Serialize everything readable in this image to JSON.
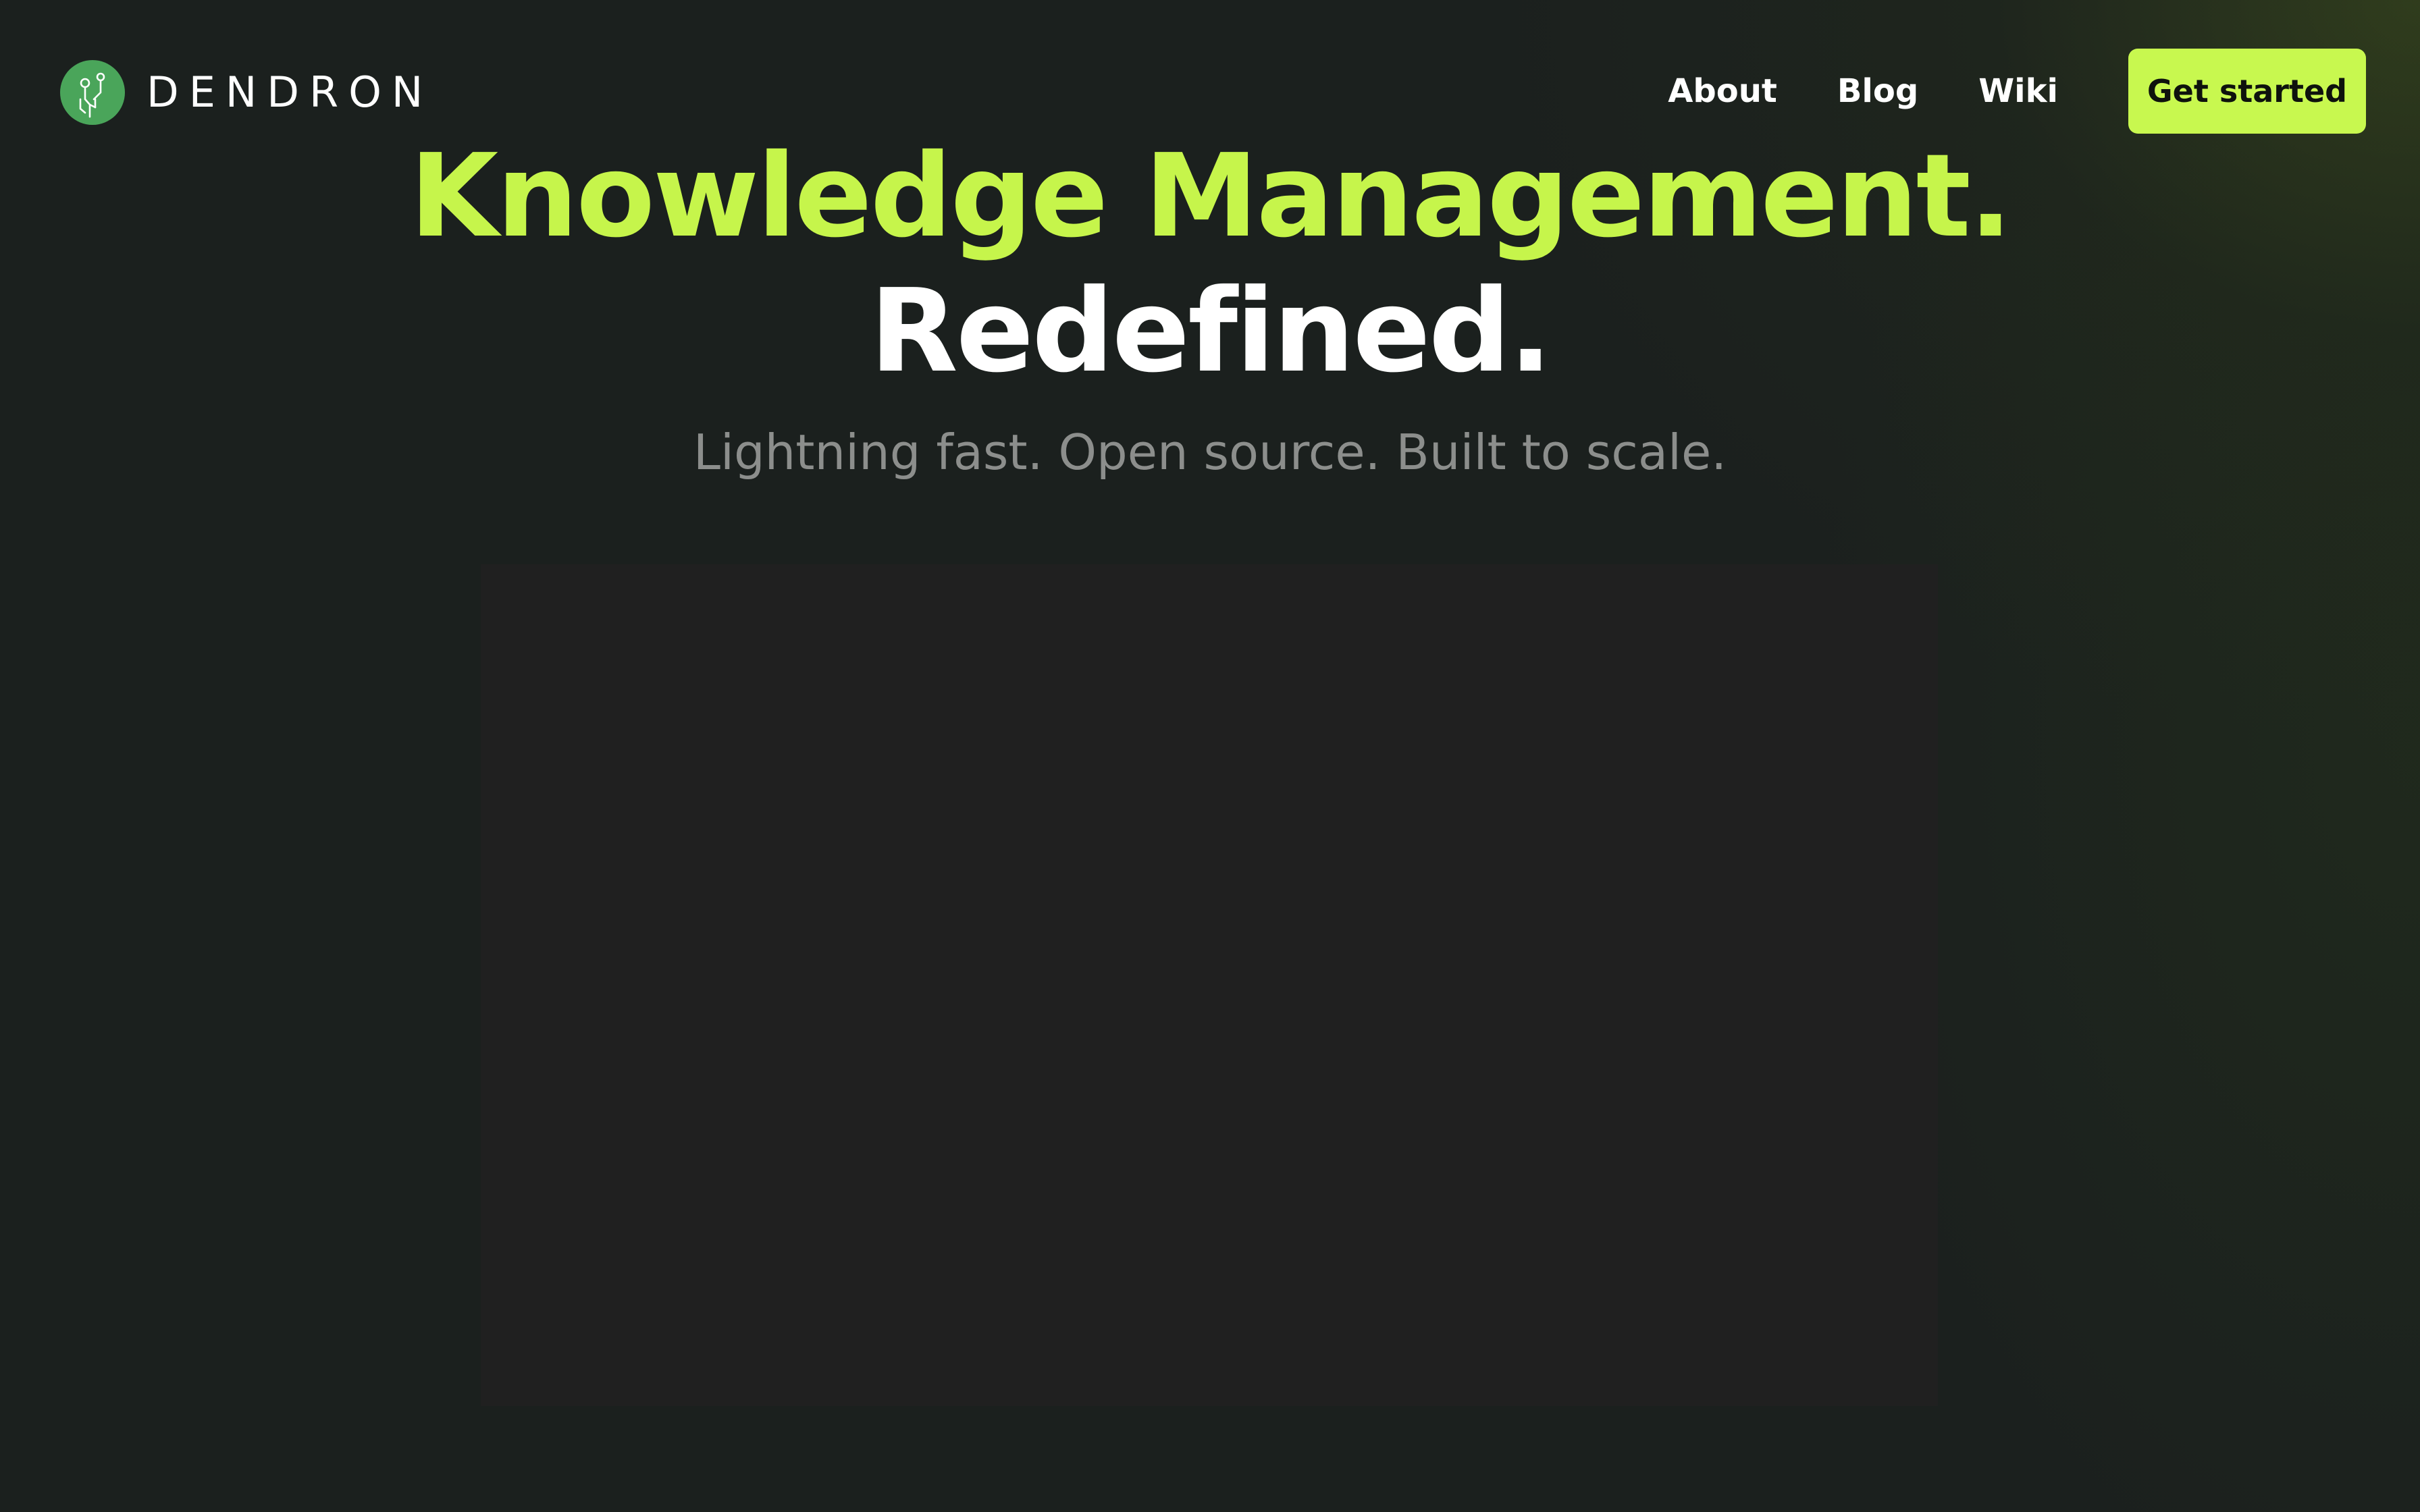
{
  "brand": {
    "name": "DENDRON",
    "logo_icon": "dendron-tree-icon",
    "logo_color": "#4aa55a"
  },
  "nav": {
    "links": [
      {
        "label": "About"
      },
      {
        "label": "Blog"
      },
      {
        "label": "Wiki"
      }
    ],
    "cta_label": "Get started"
  },
  "hero": {
    "headline_line1": "Knowledge Management.",
    "headline_line2": "Redefined.",
    "subheadline": "Lightning fast. Open source. Built to scale."
  },
  "colors": {
    "accent": "#c6f54b",
    "background": "#1b201e",
    "media_background": "#202020",
    "subtext": "#8c8e8c"
  }
}
